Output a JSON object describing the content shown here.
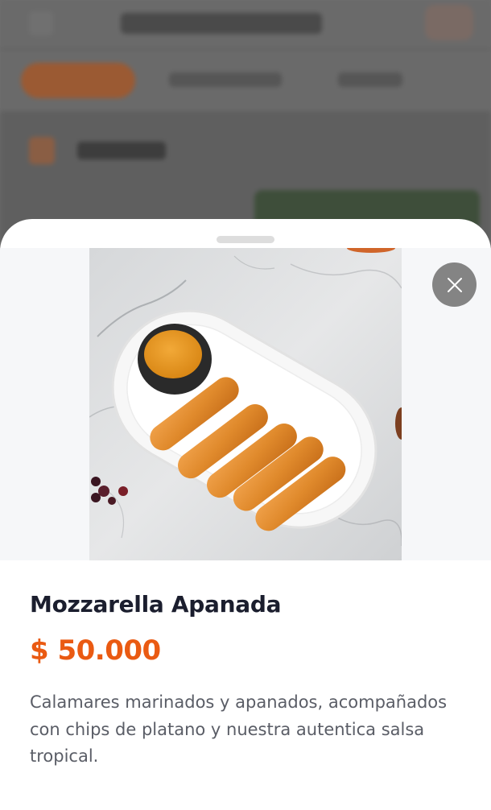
{
  "product": {
    "name": "Mozzarella Apanada",
    "price": "$ 50.000",
    "description": "Calamares marinados y apanados, acompañados con chips de platano y nuestra autentica salsa tropical."
  },
  "icons": {
    "close": "close-icon"
  },
  "colors": {
    "price_accent": "#ea5a12",
    "title": "#1b1e2e",
    "body_text": "#5a5d66",
    "close_button_bg": "#848484",
    "overlay": "#6d6d6d"
  }
}
